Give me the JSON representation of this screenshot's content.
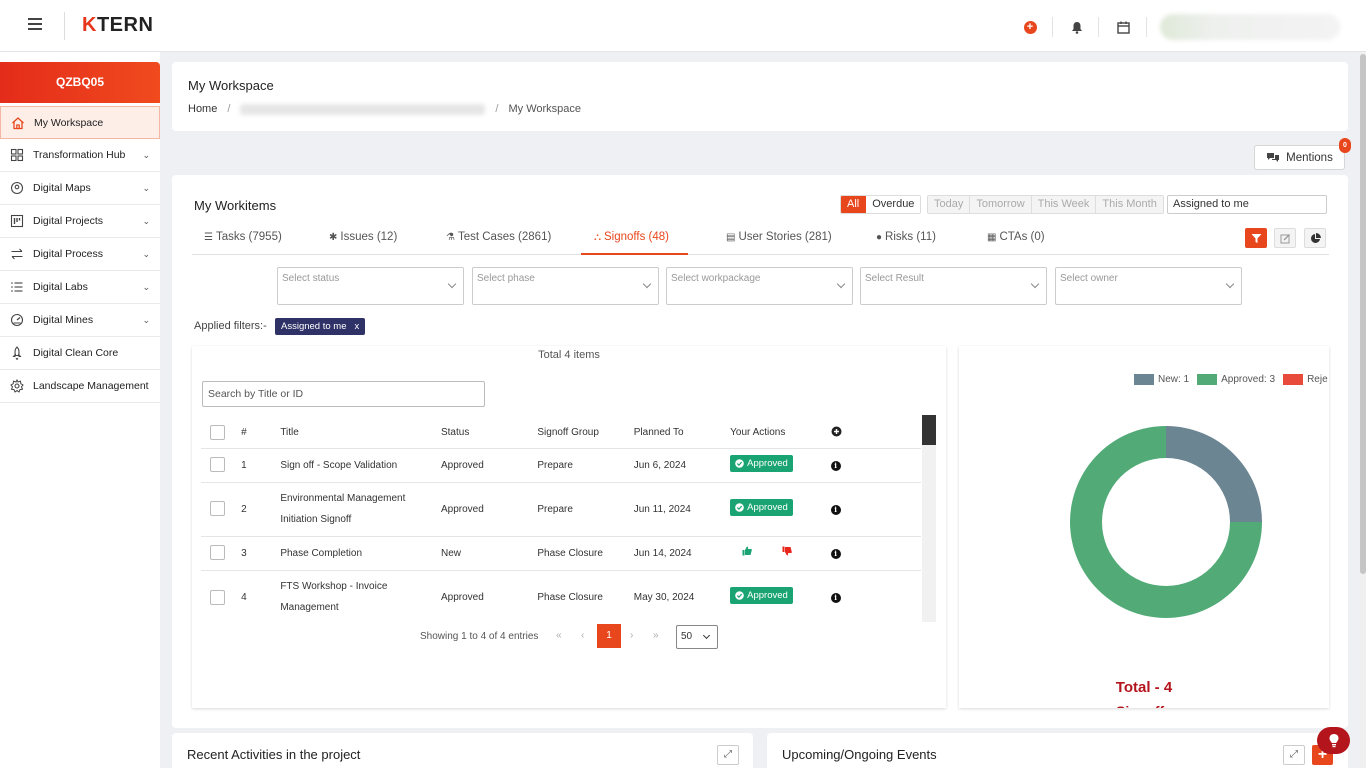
{
  "brand": {
    "logo_k": "K",
    "logo_rest": "TERN"
  },
  "header": {
    "user_name": "Sonal Kamble Mirali"
  },
  "sidebar": {
    "project_code": "QZBQ05",
    "items": [
      {
        "label": "My Workspace",
        "icon": "home-icon",
        "has_chevron": false
      },
      {
        "label": "Transformation Hub",
        "icon": "grid-icon",
        "has_chevron": true
      },
      {
        "label": "Digital Maps",
        "icon": "map-pin-icon",
        "has_chevron": true
      },
      {
        "label": "Digital Projects",
        "icon": "kanban-icon",
        "has_chevron": true
      },
      {
        "label": "Digital Process",
        "icon": "process-arrows-icon",
        "has_chevron": true
      },
      {
        "label": "Digital Labs",
        "icon": "list-icon",
        "has_chevron": true
      },
      {
        "label": "Digital Mines",
        "icon": "gauge-icon",
        "has_chevron": true
      },
      {
        "label": "Digital Clean Core",
        "icon": "rocket-icon",
        "has_chevron": false
      },
      {
        "label": "Landscape Management",
        "icon": "gear-icon",
        "has_chevron": false
      }
    ]
  },
  "workspace": {
    "title": "My Workspace",
    "breadcrumb": {
      "home": "Home",
      "middle": "Scope Validation and Project Management",
      "current": "My Workspace"
    }
  },
  "mentions": {
    "label": "Mentions",
    "count": "0"
  },
  "workitems": {
    "title": "My Workitems",
    "period_filters": [
      "All",
      "Overdue"
    ],
    "period_filters_disabled": [
      "Today",
      "Tomorrow",
      "This Week",
      "This Month"
    ],
    "active_period": "All",
    "assignee_filter": "Assigned to me",
    "tabs": [
      {
        "label": "Tasks (7955)",
        "icon": "☰"
      },
      {
        "label": "Issues (12)",
        "icon": "✱"
      },
      {
        "label": "Test Cases (2861)",
        "icon": "⚗"
      },
      {
        "label": "Signoffs (48)",
        "icon": "⛬"
      },
      {
        "label": "User Stories (281)",
        "icon": "▤"
      },
      {
        "label": "Risks (11)",
        "icon": "●"
      },
      {
        "label": "CTAs (0)",
        "icon": "▦"
      }
    ],
    "active_tab": "Signoffs (48)",
    "selects": [
      {
        "placeholder": "Select status"
      },
      {
        "placeholder": "Select phase"
      },
      {
        "placeholder": "Select workpackage"
      },
      {
        "placeholder": "Select Result"
      },
      {
        "placeholder": "Select owner"
      }
    ],
    "applied_label": "Applied filters:-",
    "applied_chip": "Assigned to me",
    "chip_close": "x"
  },
  "table": {
    "total": "Total 4 items",
    "search_placeholder": "Search by Title or ID",
    "columns": [
      "#",
      "Title",
      "Status",
      "Signoff Group",
      "Planned To",
      "Your Actions"
    ],
    "rows": [
      {
        "num": "1",
        "title": "Sign off - Scope Validation",
        "status": "Approved",
        "group": "Prepare",
        "planned": "Jun 6, 2024",
        "action": "Approved"
      },
      {
        "num": "2",
        "title": "Environmental Management Initiation Signoff",
        "status": "Approved",
        "group": "Prepare",
        "planned": "Jun 11, 2024",
        "action": "Approved"
      },
      {
        "num": "3",
        "title": "Phase Completion",
        "status": "New",
        "group": "Phase Closure",
        "planned": "Jun 14, 2024",
        "action": ""
      },
      {
        "num": "4",
        "title": "FTS Workshop - Invoice Management",
        "status": "Approved",
        "group": "Phase Closure",
        "planned": "May 30, 2024",
        "action": "Approved"
      }
    ],
    "pager": {
      "info": "Showing 1 to 4 of 4 entries",
      "current_page": "1",
      "per_page": "50",
      "first": "«",
      "prev": "‹",
      "next": "›",
      "last": "»"
    }
  },
  "chart_data": {
    "type": "pie",
    "donut": true,
    "categories": [
      "New",
      "Approved",
      "Rejected"
    ],
    "values": [
      1,
      3,
      0
    ],
    "legend_labels": [
      "New: 1",
      "Approved: 3",
      "Reje"
    ],
    "colors": [
      "#6c8592",
      "#52ab77",
      "#e84a3c"
    ],
    "legend_position": "top-right",
    "title": "Total - 4",
    "subtitle": "Signoffs"
  },
  "bottom": {
    "recent_title": "Recent Activities in the project",
    "events_title": "Upcoming/Ongoing Events",
    "add_label": "+"
  }
}
